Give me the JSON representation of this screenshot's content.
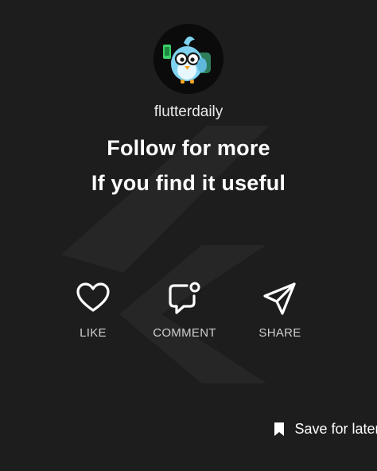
{
  "profile": {
    "username": "flutterdaily"
  },
  "headline": {
    "line1": "Follow for more",
    "line2": "If you find it useful"
  },
  "actions": [
    {
      "label": "LIKE",
      "icon": "heart-icon"
    },
    {
      "label": "COMMENT",
      "icon": "comment-icon"
    },
    {
      "label": "SHARE",
      "icon": "send-icon"
    }
  ],
  "save": {
    "label": "Save for later",
    "icon": "bookmark-icon"
  },
  "colors": {
    "background": "#1d1d1d",
    "watermark": "#2a2a2a",
    "text": "#ffffff",
    "label": "#cfcfcf"
  }
}
